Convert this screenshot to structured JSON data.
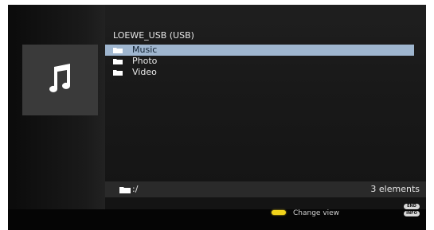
{
  "browser": {
    "title": "LOEWE_USB (USB)",
    "items": [
      {
        "label": "Music",
        "icon": "folder-icon",
        "selected": true
      },
      {
        "label": "Photo",
        "icon": "folder-icon",
        "selected": false
      },
      {
        "label": "Video",
        "icon": "folder-icon",
        "selected": false
      }
    ],
    "path": ":/",
    "count": "3 elements"
  },
  "preview": {
    "icon": "music-note-icon"
  },
  "footer": {
    "change_view_label": "Change view",
    "end_key": "END",
    "info_key": "INFO",
    "yellow_button_color": "#f0d21b"
  },
  "colors": {
    "selection": "#9fb6cf",
    "background": "#0a0a0a"
  }
}
